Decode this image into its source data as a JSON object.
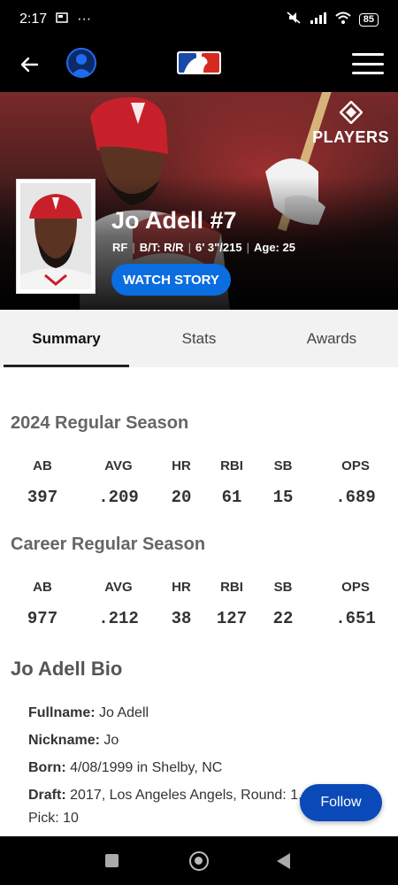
{
  "status_bar": {
    "time": "2:17",
    "battery": "85"
  },
  "hero": {
    "name": "Jo Adell #7",
    "position": "RF",
    "bats_throws": "B/T: R/R",
    "height_weight": "6' 3\"/215",
    "age": "Age: 25",
    "watch_label": "WATCH STORY",
    "players_logo_text": "PLAYERS"
  },
  "tabs": [
    "Summary",
    "Stats",
    "Awards"
  ],
  "season_2024": {
    "title": "2024 Regular Season",
    "headers": [
      "AB",
      "AVG",
      "HR",
      "RBI",
      "SB",
      "OPS"
    ],
    "values": [
      "397",
      ".209",
      "20",
      "61",
      "15",
      ".689"
    ]
  },
  "career": {
    "title": "Career Regular Season",
    "headers": [
      "AB",
      "AVG",
      "HR",
      "RBI",
      "SB",
      "OPS"
    ],
    "values": [
      "977",
      ".212",
      "38",
      "127",
      "22",
      ".651"
    ]
  },
  "bio": {
    "title": "Jo Adell Bio",
    "fullname_label": "Fullname:",
    "fullname": " Jo Adell",
    "nickname_label": "Nickname:",
    "nickname": " Jo",
    "born_label": "Born:",
    "born": " 4/08/1999 in Shelby, NC",
    "draft_label": "Draft:",
    "draft": " 2017, Los Angeles Angels, Round: 1,",
    "draft_pick": "Pick: 10"
  },
  "follow_label": "Follow",
  "colors": {
    "accent": "#0a6de0",
    "follow": "#0a49b8"
  }
}
